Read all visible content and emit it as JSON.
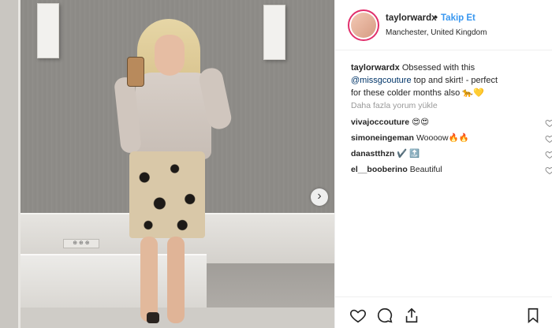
{
  "post": {
    "username": "taylorwardx",
    "separator": "•",
    "follow_label": "Takip Et",
    "location": "Manchester, United Kingdom"
  },
  "caption": {
    "username": "taylorwardx",
    "text_before": "Obsessed with this",
    "mention": "@missgcouture",
    "text_after": "top and skirt! - perfect for these colder months also",
    "emoji": "🐆💛"
  },
  "load_more_label": "Daha fazla yorum yükle",
  "comments": [
    {
      "username": "vivajoccouture",
      "text": "😍😍"
    },
    {
      "username": "simoneingeman",
      "text": "Woooow🔥🔥"
    },
    {
      "username": "danastthzn",
      "text": "✔️ 🔝"
    },
    {
      "username": "el__booberino",
      "text": "Beautiful"
    }
  ],
  "photo": {
    "outlet_text": "⊕ ⊕ ⊕",
    "next_icon": "chevron-right-icon"
  },
  "icons": [
    "heart-icon",
    "comment-icon",
    "share-icon",
    "bookmark-icon"
  ],
  "colors": {
    "follow": "#3897f0",
    "mention": "#003569",
    "story_ring": "#e1306c"
  }
}
